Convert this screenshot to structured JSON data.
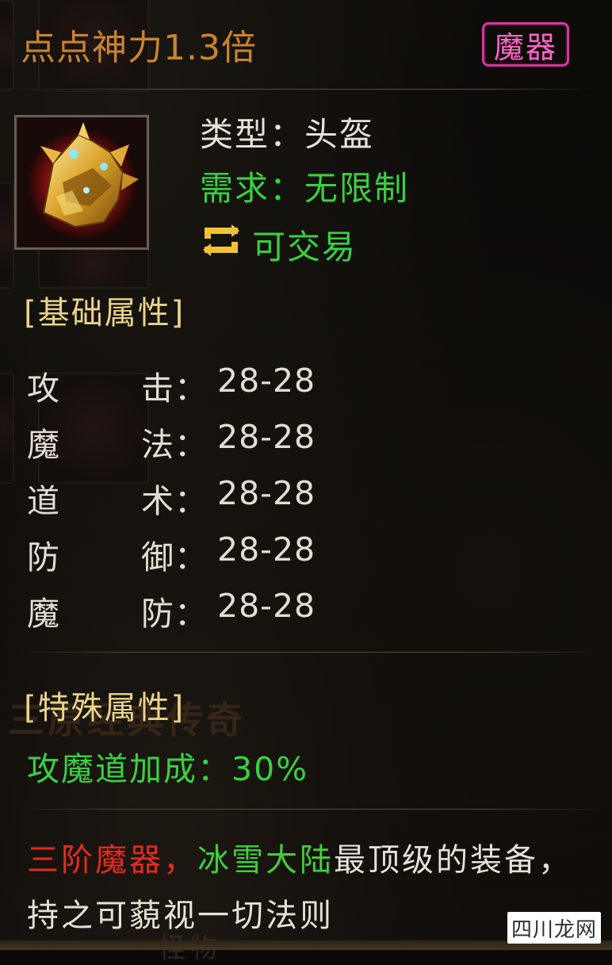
{
  "tooltip": {
    "title": "点点神力1.3倍",
    "badge": "魔器",
    "item": {
      "icon": "golden-helmet-icon",
      "type_label": "类型：头盔",
      "requirement_label": "需求：无限制",
      "trade_label": "可交易"
    },
    "basic_section": {
      "header": "[基础属性]",
      "stats": [
        {
          "c1": "攻",
          "c2": "击",
          "colon": "：",
          "value": "28-28"
        },
        {
          "c1": "魔",
          "c2": "法",
          "colon": "：",
          "value": "28-28"
        },
        {
          "c1": "道",
          "c2": "术",
          "colon": "：",
          "value": "28-28"
        },
        {
          "c1": "防",
          "c2": "御",
          "colon": "：",
          "value": "28-28"
        },
        {
          "c1": "魔",
          "c2": "防",
          "colon": "：",
          "value": "28-28"
        }
      ]
    },
    "special_section": {
      "header": "[特殊属性]",
      "bonus": "攻魔道加成：30%"
    },
    "description": {
      "part_red": "三阶魔器，",
      "part_green": "冰雪大陆",
      "part_white": "最顶级的装备，持之可藐视一切法则"
    }
  },
  "background": {
    "watermark_text": "三原经典传奇",
    "bottom_text": "怪物"
  },
  "site_logo": "四川龙网",
  "colors": {
    "title": "#c9852d",
    "badge": "#ff63c8",
    "green": "#38d141",
    "red": "#e52a1c",
    "header": "#ead38a"
  }
}
